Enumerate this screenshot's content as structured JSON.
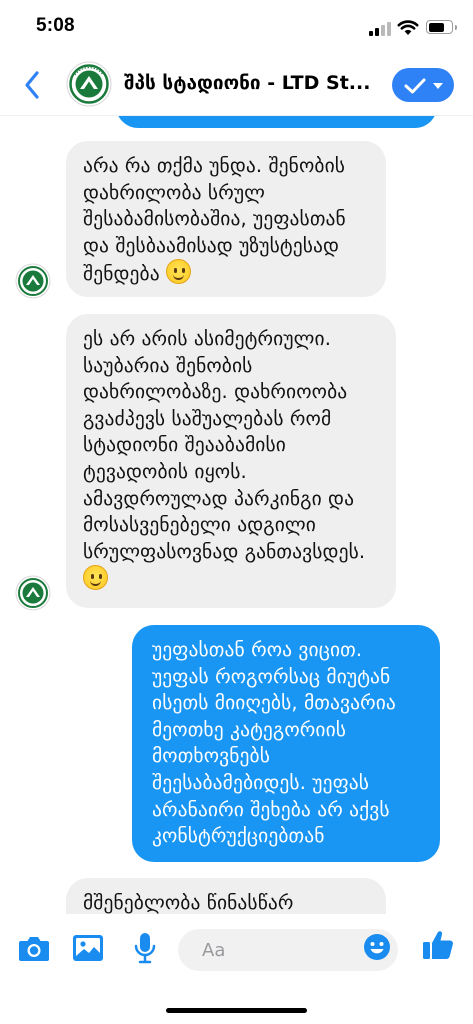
{
  "status_bar": {
    "time": "5:08"
  },
  "header": {
    "title": "შპს სტადიონი - LTD St...",
    "back_icon": "chevron-left-icon",
    "action_icon": "check-icon"
  },
  "messages": [
    {
      "direction": "outgoing",
      "text": "",
      "partial": true
    },
    {
      "direction": "incoming",
      "text": "არა რა თქმა უნდა. შენობის დახრილობა სრულ შესაბამისობაშია, უეფასთან და შესბაამისად უზუსტესად შენდება",
      "emoji": "slightly-smiling-face"
    },
    {
      "direction": "incoming",
      "text": "ეს არ არის ასიმეტრიული. საუბარია შენობის დახრილობაზე. დახრიოობა გვაძპევს საშუალებას რომ სტადიონი შეააბამისი ტევადობის იყოს. ამავდროულად პარკინგი და მოსასვენებელი ადგილი სრულფასოვნად განთავსდეს.",
      "emoji": "slightly-smiling-face"
    },
    {
      "direction": "outgoing",
      "text": "უეფასთან როა ვიცით. უეფას როგორსაც მიუტან ისეთს მიიღებს, მთავარია მეოთხე კატეგორიის მოთხოვნებს შეესაბამებიდეს. უეფას არანაირი შეხება არ აქვს კონსტრუქციებთან"
    },
    {
      "direction": "incoming",
      "text": "მშენებლობა წინასწარ",
      "partial": true
    }
  ],
  "composer": {
    "placeholder": "Aa",
    "icons": [
      "camera-icon",
      "image-icon",
      "microphone-icon",
      "emoji-icon",
      "thumbs-up-icon"
    ]
  },
  "colors": {
    "accent": "#2f82f5",
    "outgoing_bubble": "#1996f3",
    "incoming_bubble": "#efefef",
    "logo_green": "#1a7a3c"
  }
}
